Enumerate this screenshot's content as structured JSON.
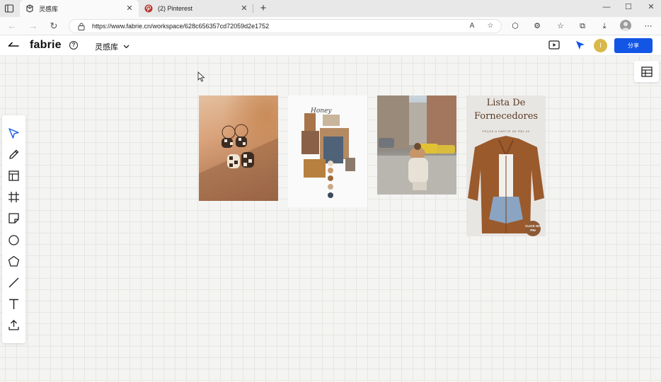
{
  "browser": {
    "tabs": [
      {
        "title": "灵感库",
        "icon": "fabrie-tab-icon",
        "active": true
      },
      {
        "title": "(2) Pinterest",
        "icon": "pinterest-icon",
        "active": false
      }
    ],
    "new_tab_label": "+",
    "address": {
      "url": "https://www.fabrie.cn/workspace/628c656357cd72059d2e1752"
    }
  },
  "app": {
    "logo": "fabrie",
    "workspace_name": "灵感库",
    "avatar_initial": "I",
    "share_label": "分享",
    "accent_color": "#1356e6"
  },
  "toolbar": {
    "tools": [
      "select-tool",
      "pen-tool",
      "layout-tool",
      "frame-tool",
      "sticky-note-tool",
      "circle-tool",
      "polygon-tool",
      "line-tool",
      "text-tool",
      "upload-tool"
    ]
  },
  "board": {
    "pins": [
      {
        "name": "earrings-photo"
      },
      {
        "name": "honey-moodboard",
        "caption": "Honey"
      },
      {
        "name": "street-fashion-photo"
      },
      {
        "name": "suppliers-list",
        "title_line1": "Lista De",
        "title_line2": "Fornecedores",
        "subtitle": "PEÇAS A PARTIR DE R$1,00",
        "badge": "CLICK NO PIN"
      }
    ]
  }
}
